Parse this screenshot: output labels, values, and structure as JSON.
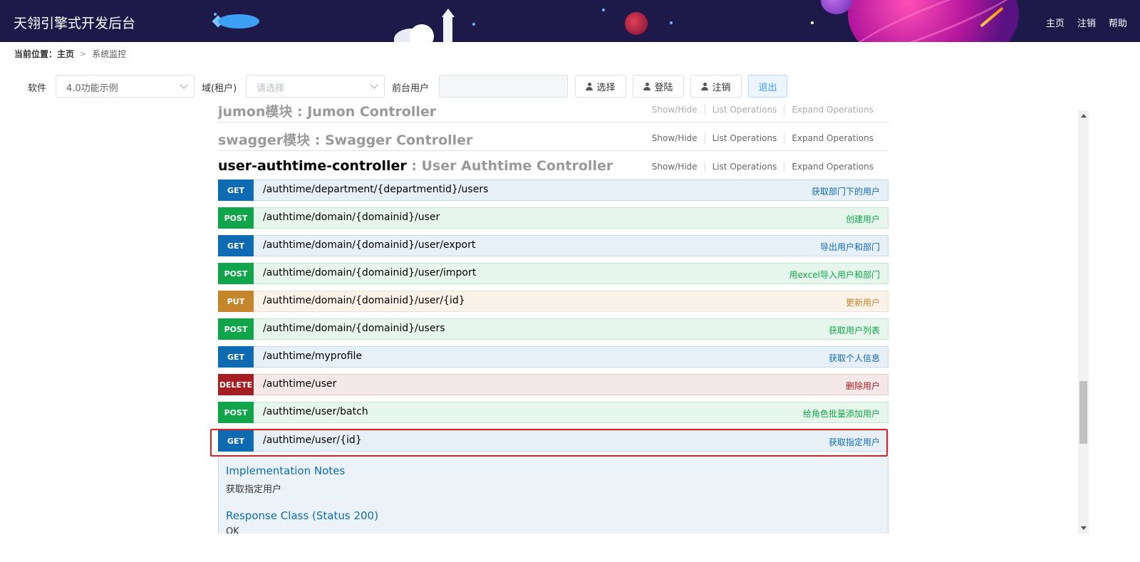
{
  "header": {
    "brand": "天翎引擎式开发后台",
    "nav": [
      "主页",
      "注销",
      "帮助"
    ]
  },
  "breadcrumb": {
    "label": "当前位置：",
    "home": "主页",
    "current": "系统监控"
  },
  "toolbar": {
    "software_label": "软件",
    "software_value": "4.0功能示例",
    "domain_label": "域(租户)",
    "domain_placeholder": "请选择",
    "frontend_user_label": "前台用户",
    "frontend_user_value": "",
    "select_button": "选择",
    "login_button": "登陆",
    "logout_button": "注销",
    "exit_button": "退出"
  },
  "sections": [
    {
      "name": "jumon模块 : Jumon Controller",
      "desc": "",
      "links": [
        "Show/Hide",
        "List Operations",
        "Expand Operations"
      ]
    },
    {
      "name": "swagger模块",
      "desc": " : Swagger Controller",
      "links": [
        "Show/Hide",
        "List Operations",
        "Expand Operations"
      ]
    },
    {
      "name": "user-authtime-controller",
      "desc": " : User Authtime Controller",
      "links": [
        "Show/Hide",
        "List Operations",
        "Expand Operations"
      ]
    }
  ],
  "operations": [
    {
      "method": "GET",
      "path": "/authtime/department/{departmentid}/users",
      "summary": "获取部门下的用户"
    },
    {
      "method": "POST",
      "path": "/authtime/domain/{domainid}/user",
      "summary": "创建用户"
    },
    {
      "method": "GET",
      "path": "/authtime/domain/{domainid}/user/export",
      "summary": "导出用户和部门"
    },
    {
      "method": "POST",
      "path": "/authtime/domain/{domainid}/user/import",
      "summary": "用excel导入用户和部门"
    },
    {
      "method": "PUT",
      "path": "/authtime/domain/{domainid}/user/{id}",
      "summary": "更新用户"
    },
    {
      "method": "POST",
      "path": "/authtime/domain/{domainid}/users",
      "summary": "获取用户列表"
    },
    {
      "method": "GET",
      "path": "/authtime/myprofile",
      "summary": "获取个人信息"
    },
    {
      "method": "DELETE",
      "path": "/authtime/user",
      "summary": "删除用户"
    },
    {
      "method": "POST",
      "path": "/authtime/user/batch",
      "summary": "给角色批量添加用户"
    },
    {
      "method": "GET",
      "path": "/authtime/user/{id}",
      "summary": "获取指定用户"
    }
  ],
  "details": {
    "impl_heading": "Implementation Notes",
    "impl_text": "获取指定用户",
    "response_heading": "Response Class (Status 200)",
    "response_text": "OK"
  },
  "colors": {
    "header_bg": "#1d1a4a",
    "get": "#0f6ab4",
    "post": "#10a54a",
    "put": "#c5862b",
    "delete": "#a41e22",
    "highlight": "#e01f1f"
  }
}
